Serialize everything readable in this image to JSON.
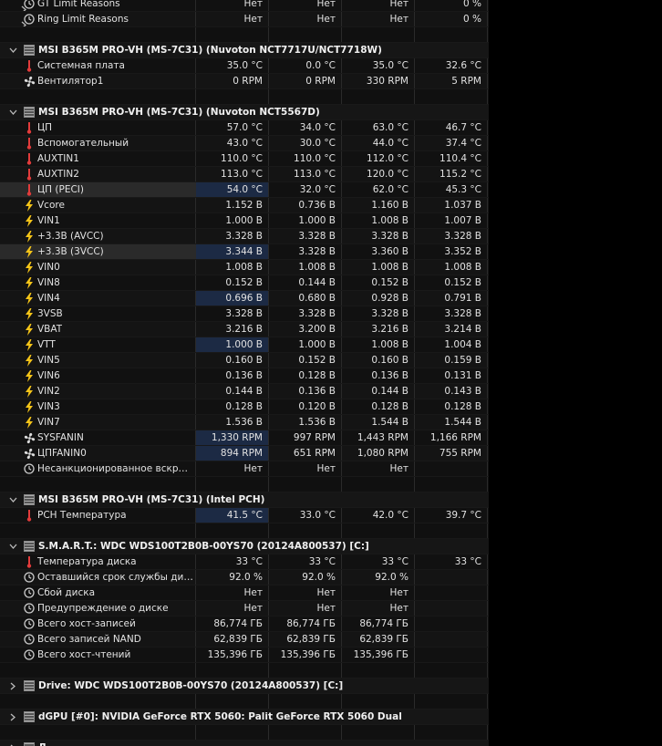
{
  "sections": [
    {
      "kind": "tail",
      "rows": [
        {
          "icon": "clock",
          "name": "GT Limit Reasons",
          "values": [
            "Нет",
            "Нет",
            "Нет",
            "0 %"
          ],
          "chevron": true
        },
        {
          "icon": "clock",
          "name": "Ring Limit Reasons",
          "values": [
            "Нет",
            "Нет",
            "Нет",
            "0 %"
          ],
          "chevron": true
        }
      ]
    },
    {
      "kind": "group",
      "title": "MSI B365M PRO-VH (MS-7C31) (Nuvoton NCT7717U/NCT7718W)",
      "expanded": true,
      "rows": [
        {
          "icon": "temp",
          "name": "Системная плата",
          "values": [
            "35.0 °C",
            "0.0 °C",
            "35.0 °C",
            "32.6 °C"
          ]
        },
        {
          "icon": "fan",
          "name": "Вентилятор1",
          "values": [
            "0 RPM",
            "0 RPM",
            "330 RPM",
            "5 RPM"
          ]
        }
      ]
    },
    {
      "kind": "group",
      "title": "MSI B365M PRO-VH (MS-7C31) (Nuvoton NCT5567D)",
      "expanded": true,
      "rows": [
        {
          "icon": "temp",
          "name": "ЦП",
          "values": [
            "57.0 °C",
            "34.0 °C",
            "63.0 °C",
            "46.7 °C"
          ]
        },
        {
          "icon": "temp",
          "name": "Вспомогательный",
          "values": [
            "43.0 °C",
            "30.0 °C",
            "44.0 °C",
            "37.4 °C"
          ]
        },
        {
          "icon": "temp",
          "name": "AUXTIN1",
          "values": [
            "110.0 °C",
            "110.0 °C",
            "112.0 °C",
            "110.4 °C"
          ]
        },
        {
          "icon": "temp",
          "name": "AUXTIN2",
          "values": [
            "113.0 °C",
            "113.0 °C",
            "120.0 °C",
            "115.2 °C"
          ]
        },
        {
          "icon": "temp",
          "name": "ЦП (PECI)",
          "values": [
            "54.0 °C",
            "32.0 °C",
            "62.0 °C",
            "45.3 °C"
          ],
          "sel": true,
          "hl": true
        },
        {
          "icon": "volt",
          "name": "Vcore",
          "values": [
            "1.152 В",
            "0.736 В",
            "1.160 В",
            "1.037 В"
          ]
        },
        {
          "icon": "volt",
          "name": "VIN1",
          "values": [
            "1.000 В",
            "1.000 В",
            "1.008 В",
            "1.007 В"
          ]
        },
        {
          "icon": "volt",
          "name": "+3.3В (AVCC)",
          "values": [
            "3.328 В",
            "3.328 В",
            "3.328 В",
            "3.328 В"
          ]
        },
        {
          "icon": "volt",
          "name": "+3.3В (3VCC)",
          "values": [
            "3.344 В",
            "3.328 В",
            "3.360 В",
            "3.352 В"
          ],
          "sel": true,
          "hl": true
        },
        {
          "icon": "volt",
          "name": "VIN0",
          "values": [
            "1.008 В",
            "1.008 В",
            "1.008 В",
            "1.008 В"
          ]
        },
        {
          "icon": "volt",
          "name": "VIN8",
          "values": [
            "0.152 В",
            "0.144 В",
            "0.152 В",
            "0.152 В"
          ]
        },
        {
          "icon": "volt",
          "name": "VIN4",
          "values": [
            "0.696 В",
            "0.680 В",
            "0.928 В",
            "0.791 В"
          ],
          "sel": true
        },
        {
          "icon": "volt",
          "name": "3VSB",
          "values": [
            "3.328 В",
            "3.328 В",
            "3.328 В",
            "3.328 В"
          ]
        },
        {
          "icon": "volt",
          "name": "VBAT",
          "values": [
            "3.216 В",
            "3.200 В",
            "3.216 В",
            "3.214 В"
          ]
        },
        {
          "icon": "volt",
          "name": "VTT",
          "values": [
            "1.000 В",
            "1.000 В",
            "1.008 В",
            "1.004 В"
          ],
          "sel": true
        },
        {
          "icon": "volt",
          "name": "VIN5",
          "values": [
            "0.160 В",
            "0.152 В",
            "0.160 В",
            "0.159 В"
          ]
        },
        {
          "icon": "volt",
          "name": "VIN6",
          "values": [
            "0.136 В",
            "0.128 В",
            "0.136 В",
            "0.131 В"
          ]
        },
        {
          "icon": "volt",
          "name": "VIN2",
          "values": [
            "0.144 В",
            "0.136 В",
            "0.144 В",
            "0.143 В"
          ]
        },
        {
          "icon": "volt",
          "name": "VIN3",
          "values": [
            "0.128 В",
            "0.120 В",
            "0.128 В",
            "0.128 В"
          ]
        },
        {
          "icon": "volt",
          "name": "VIN7",
          "values": [
            "1.536 В",
            "1.536 В",
            "1.544 В",
            "1.544 В"
          ]
        },
        {
          "icon": "fan",
          "name": "SYSFANIN",
          "values": [
            "1,330 RPM",
            "997 RPM",
            "1,443 RPM",
            "1,166 RPM"
          ],
          "sel": true
        },
        {
          "icon": "fan",
          "name": "ЦПFANIN0",
          "values": [
            "894 RPM",
            "651 RPM",
            "1,080 RPM",
            "755 RPM"
          ],
          "sel": true
        },
        {
          "icon": "clock",
          "name": "Несанкционированное вскрыт...",
          "values": [
            "Нет",
            "Нет",
            "Нет",
            ""
          ]
        }
      ]
    },
    {
      "kind": "group",
      "title": "MSI B365M PRO-VH (MS-7C31) (Intel PCH)",
      "expanded": true,
      "rows": [
        {
          "icon": "temp",
          "name": "PCH Температура",
          "values": [
            "41.5 °C",
            "33.0 °C",
            "42.0 °C",
            "39.7 °C"
          ],
          "sel": true
        }
      ]
    },
    {
      "kind": "group",
      "title": "S.M.A.R.T.: WDC WDS100T2B0B-00YS70 (20124A800537) [C:]",
      "expanded": true,
      "rows": [
        {
          "icon": "temp",
          "name": "Температура диска",
          "values": [
            "33 °C",
            "33 °C",
            "33 °C",
            "33 °C"
          ]
        },
        {
          "icon": "clock",
          "name": "Оставшийся срок службы диска",
          "values": [
            "92.0 %",
            "92.0 %",
            "92.0 %",
            ""
          ]
        },
        {
          "icon": "clock",
          "name": "Сбой диска",
          "values": [
            "Нет",
            "Нет",
            "Нет",
            ""
          ]
        },
        {
          "icon": "clock",
          "name": "Предупреждение о диске",
          "values": [
            "Нет",
            "Нет",
            "Нет",
            ""
          ]
        },
        {
          "icon": "clock",
          "name": "Всего хост-записей",
          "values": [
            "86,774 ГБ",
            "86,774 ГБ",
            "86,774 ГБ",
            ""
          ]
        },
        {
          "icon": "clock",
          "name": "Всего записей NAND",
          "values": [
            "62,839 ГБ",
            "62,839 ГБ",
            "62,839 ГБ",
            ""
          ]
        },
        {
          "icon": "clock",
          "name": "Всего хост-чтений",
          "values": [
            "135,396 ГБ",
            "135,396 ГБ",
            "135,396 ГБ",
            ""
          ]
        }
      ]
    },
    {
      "kind": "group",
      "title": "Drive: WDC WDS100T2B0B-00YS70 (20124A800537) [C:]",
      "expanded": false,
      "rows": []
    },
    {
      "kind": "group",
      "title": "dGPU [#0]: NVIDIA GeForce RTX 5060: Palit GeForce RTX 5060 Dual",
      "expanded": false,
      "rows": []
    },
    {
      "kind": "group",
      "title": "Д...",
      "expanded": false,
      "rows": []
    }
  ],
  "colors": {
    "temp_icon": "#e23b3b",
    "volt_icon": "#f5c518",
    "sel_cell": "#1c2a44"
  }
}
